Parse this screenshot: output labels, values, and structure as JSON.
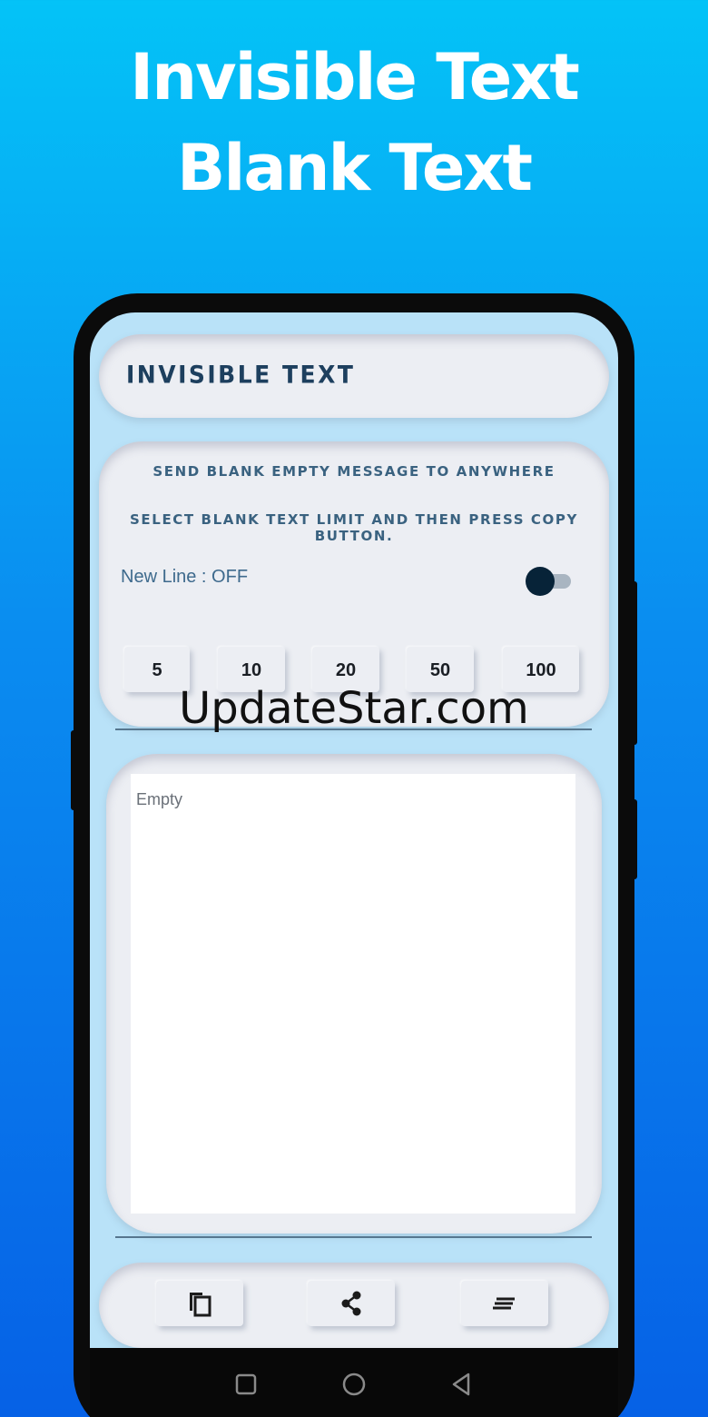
{
  "promo": {
    "line1": "Invisible Text",
    "line2": "Blank Text"
  },
  "app": {
    "title": "INVISIBLE TEXT",
    "instructions": [
      "SEND BLANK EMPTY MESSAGE TO ANYWHERE",
      "SELECT BLANK TEXT LIMIT AND THEN PRESS COPY BUTTON."
    ],
    "new_line_label": "New Line : OFF",
    "new_line_toggle_on": false,
    "limits": [
      "5",
      "10",
      "20",
      "50",
      "100"
    ],
    "output_placeholder": "Empty",
    "output_value": "",
    "actions": [
      {
        "name": "copy",
        "icon": "copy-icon"
      },
      {
        "name": "share",
        "icon": "share-icon"
      },
      {
        "name": "clear",
        "icon": "clear-format-icon"
      }
    ]
  },
  "system_nav": [
    "recents-icon",
    "home-icon",
    "back-icon"
  ],
  "watermark": "UpdateStar.com",
  "colors": {
    "background_top": "#04c3f7",
    "background_bottom": "#0661e6",
    "screen": "#b9e2f8",
    "card": "#eceef3",
    "title_text": "#1d3f5e",
    "toggle_thumb": "#072338"
  }
}
